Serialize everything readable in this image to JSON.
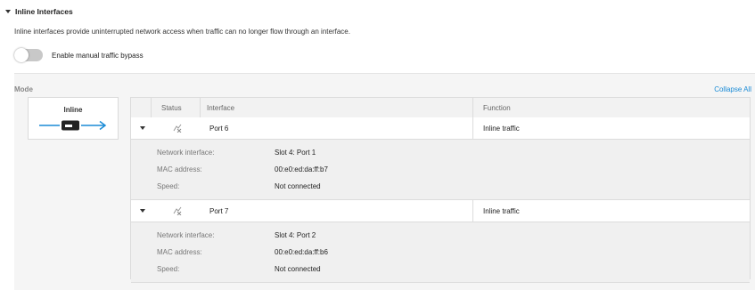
{
  "section": {
    "title": "Inline Interfaces",
    "description": "Inline interfaces provide uninterrupted network access when traffic can no longer flow through an interface."
  },
  "bypass_toggle": {
    "label": "Enable manual traffic bypass",
    "enabled": false
  },
  "panel": {
    "mode_label": "Mode",
    "collapse_all": "Collapse All",
    "mode_card": {
      "title": "Inline",
      "icon": "inline-device-icon"
    }
  },
  "table": {
    "headers": {
      "status": "Status",
      "interface": "Interface",
      "function": "Function"
    },
    "rows": [
      {
        "interface": "Port 6",
        "function": "Inline traffic",
        "status_icon": "disconnected-link-icon",
        "details": {
          "network_interface_label": "Network interface:",
          "network_interface": "Slot 4: Port 1",
          "mac_label": "MAC address:",
          "mac": "00:e0:ed:da:ff:b7",
          "speed_label": "Speed:",
          "speed": "Not connected"
        }
      },
      {
        "interface": "Port 7",
        "function": "Inline traffic",
        "status_icon": "disconnected-link-icon",
        "details": {
          "network_interface_label": "Network interface:",
          "network_interface": "Slot 4: Port 2",
          "mac_label": "MAC address:",
          "mac": "00:e0:ed:da:ff:b6",
          "speed_label": "Speed:",
          "speed": "Not connected"
        }
      }
    ]
  },
  "colors": {
    "link": "#1a8bd6",
    "mode_icon": "#1a8bd6",
    "panel_bg": "#f5f5f5"
  }
}
